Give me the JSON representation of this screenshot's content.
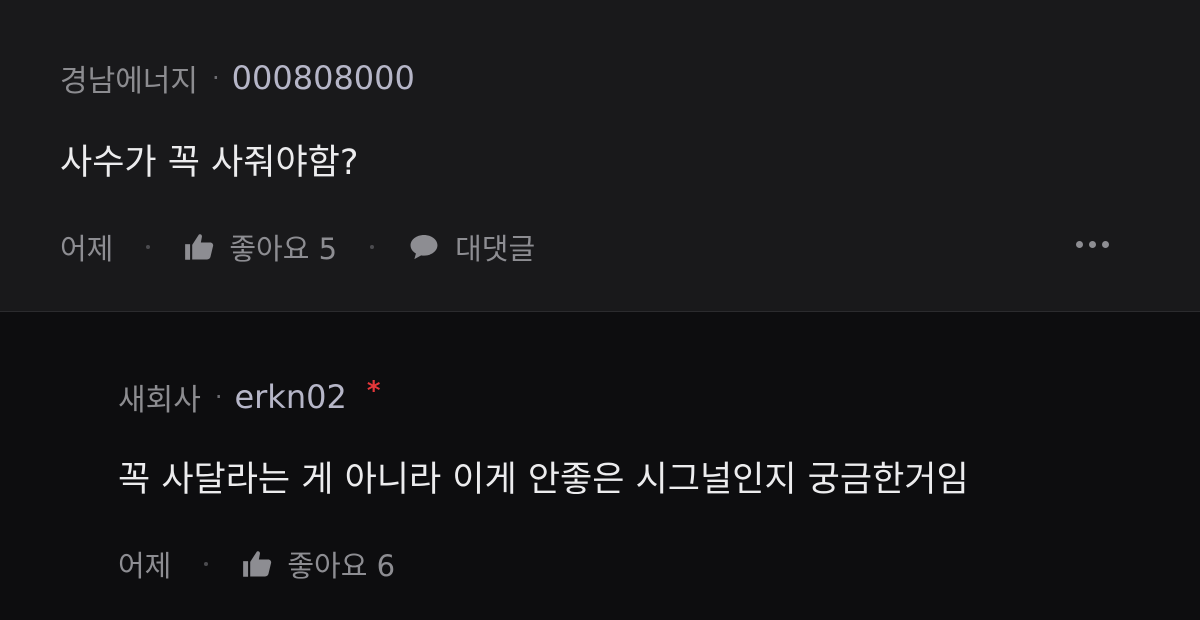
{
  "comments": [
    {
      "company": "경남에너지",
      "separator": "·",
      "username": "000808000",
      "text": "사수가 꼭 사줘야함?",
      "time": "어제",
      "like_label": "좋아요",
      "like_count": "5",
      "reply_label": "대댓글",
      "icons": [
        "thumbs-up-icon",
        "speech-bubble-icon",
        "more-options-icon"
      ]
    }
  ],
  "replies": [
    {
      "company": "새회사",
      "separator": "·",
      "username": "erkn02",
      "author_marker": "*",
      "text": "꼭 사달라는 게 아니라 이게 안좋은 시그널인지 궁금한거임",
      "time": "어제",
      "like_label": "좋아요",
      "like_count": "6",
      "icons": [
        "thumbs-up-icon"
      ]
    }
  ],
  "colors": {
    "top_background": "#19191b",
    "reply_background": "#0d0d0f",
    "author_marker": "#e5373a"
  }
}
